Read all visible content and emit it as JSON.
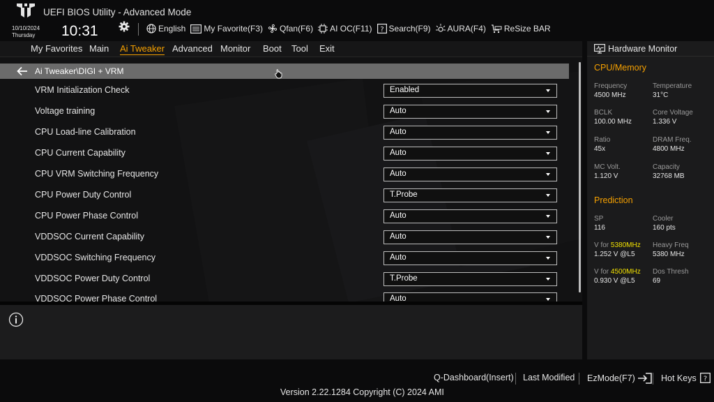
{
  "header": {
    "title": "UEFI BIOS Utility - Advanced Mode",
    "date": "10/10/2024",
    "day": "Thursday",
    "time": "10:31",
    "tools": [
      {
        "label": "English",
        "icon": "globe-icon"
      },
      {
        "label": "My Favorite(F3)",
        "icon": "favorite-icon"
      },
      {
        "label": "Qfan(F6)",
        "icon": "fan-icon"
      },
      {
        "label": "AI OC(F11)",
        "icon": "ai-oc-icon"
      },
      {
        "label": "Search(F9)",
        "icon": "search-icon"
      },
      {
        "label": "AURA(F4)",
        "icon": "aura-icon"
      },
      {
        "label": "ReSize BAR",
        "icon": "resize-bar-icon"
      }
    ]
  },
  "menu": {
    "items": [
      "My Favorites",
      "Main",
      "Ai Tweaker",
      "Advanced",
      "Monitor",
      "Boot",
      "Tool",
      "Exit"
    ],
    "active": "Ai Tweaker"
  },
  "breadcrumb": "Ai Tweaker\\DIGI + VRM",
  "settings": [
    {
      "label": "VRM Initialization Check",
      "value": "Enabled"
    },
    {
      "label": "Voltage training",
      "value": "Auto"
    },
    {
      "label": "CPU Load-line Calibration",
      "value": "Auto"
    },
    {
      "label": "CPU Current Capability",
      "value": "Auto"
    },
    {
      "label": "CPU VRM Switching Frequency",
      "value": "Auto"
    },
    {
      "label": "CPU Power Duty Control",
      "value": "T.Probe"
    },
    {
      "label": "CPU Power Phase Control",
      "value": "Auto"
    },
    {
      "label": "VDDSOC Current Capability",
      "value": "Auto"
    },
    {
      "label": "VDDSOC Switching Frequency",
      "value": "Auto"
    },
    {
      "label": "VDDSOC Power Duty Control",
      "value": "T.Probe"
    },
    {
      "label": "VDDSOC Power Phase Control",
      "value": "Auto"
    }
  ],
  "hardware_monitor": {
    "title": "Hardware Monitor",
    "cpu_memory": {
      "heading": "CPU/Memory",
      "frequency": {
        "label": "Frequency",
        "value": "4500 MHz"
      },
      "temperature": {
        "label": "Temperature",
        "value": "31°C"
      },
      "bclk": {
        "label": "BCLK",
        "value": "100.00 MHz"
      },
      "core_voltage": {
        "label": "Core Voltage",
        "value": "1.336 V"
      },
      "ratio": {
        "label": "Ratio",
        "value": "45x"
      },
      "dram_freq": {
        "label": "DRAM Freq.",
        "value": "4800 MHz"
      },
      "mc_volt": {
        "label": "MC Volt.",
        "value": "1.120 V"
      },
      "capacity": {
        "label": "Capacity",
        "value": "32768 MB"
      }
    },
    "prediction": {
      "heading": "Prediction",
      "sp": {
        "label": "SP",
        "value": "116"
      },
      "cooler": {
        "label": "Cooler",
        "value": "160 pts"
      },
      "v_for_1": {
        "prefix": "V for ",
        "freq": "5380MHz",
        "value": "1.252 V @L5"
      },
      "heavy_freq": {
        "label": "Heavy Freq",
        "value": "5380 MHz"
      },
      "v_for_2": {
        "prefix": "V for ",
        "freq": "4500MHz",
        "value": "0.930 V @L5"
      },
      "dos_thresh": {
        "label": "Dos Thresh",
        "value": "69"
      }
    }
  },
  "footer": {
    "q_dashboard": "Q-Dashboard(Insert)",
    "last_modified": "Last Modified",
    "ezmode": "EzMode(F7)",
    "hot_keys": "Hot Keys",
    "version": "Version 2.22.1284 Copyright (C) 2024 AMI"
  },
  "colors": {
    "accent": "#f5a000",
    "highlight": "#f2e100",
    "breadcrumb_bar": "#6b6b6b"
  }
}
